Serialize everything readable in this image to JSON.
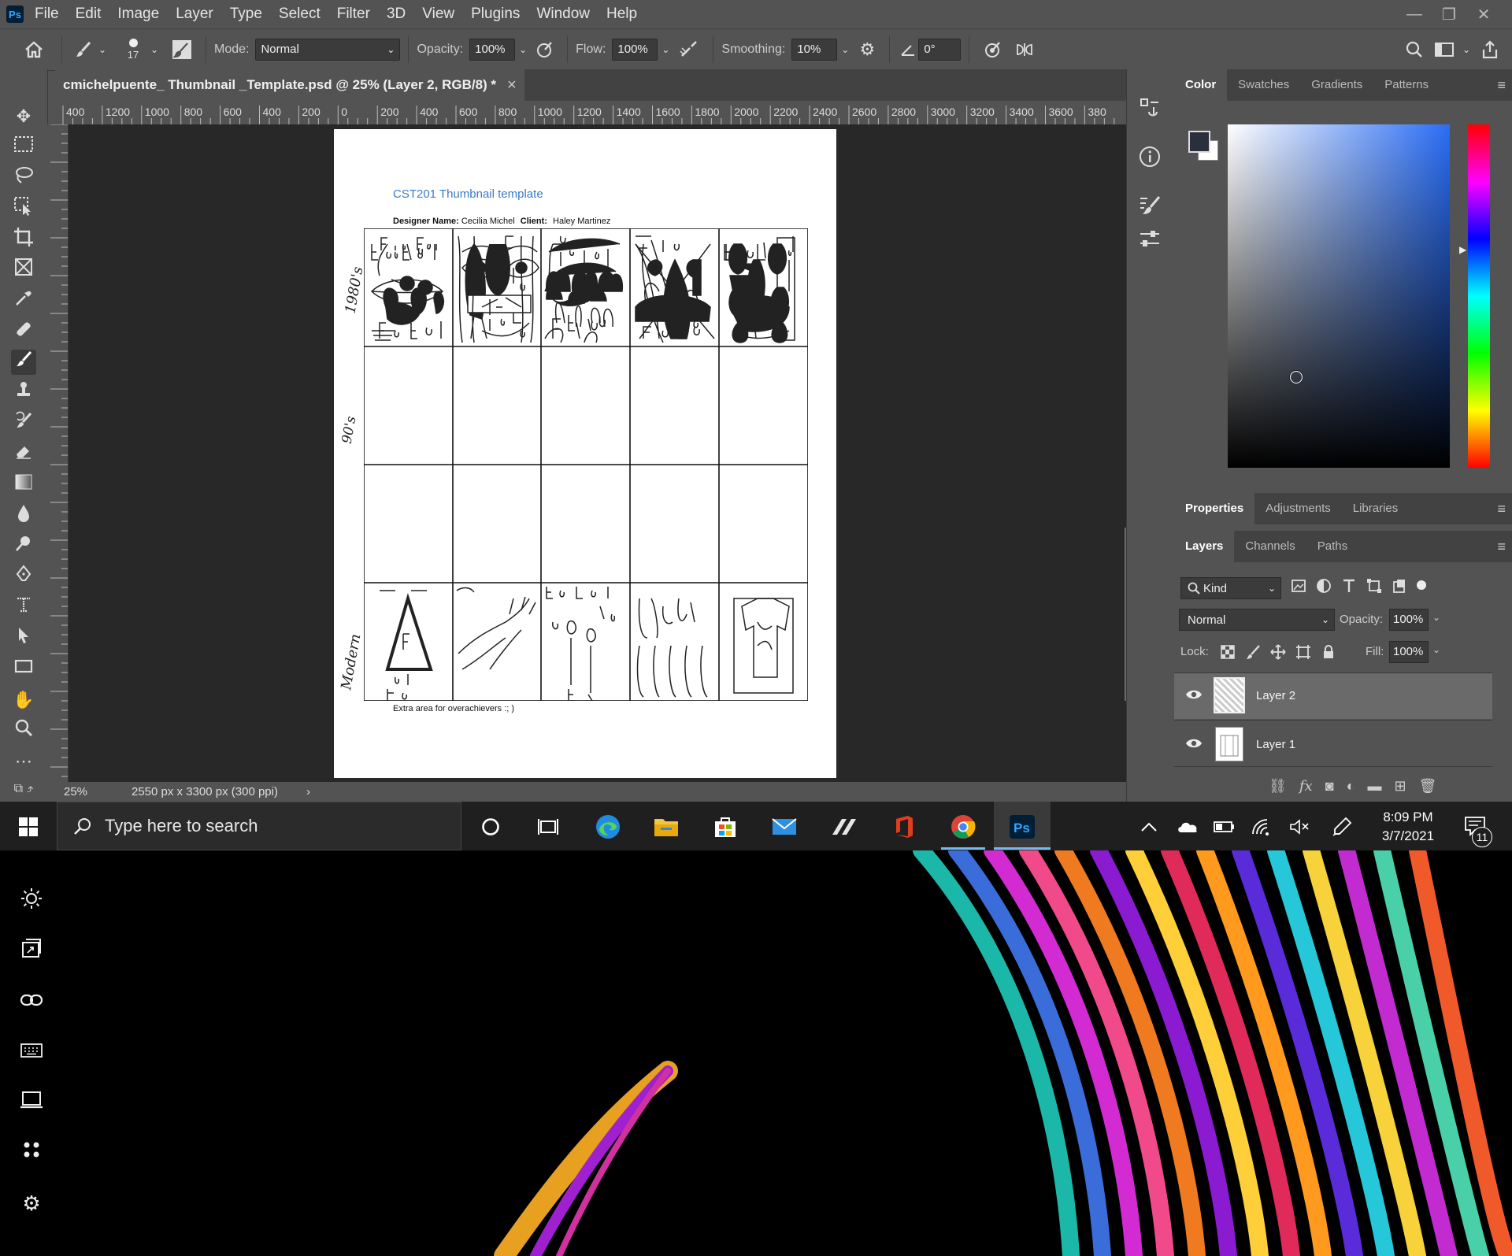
{
  "app": {
    "logo": "Ps",
    "menu": [
      "File",
      "Edit",
      "Image",
      "Layer",
      "Type",
      "Select",
      "Filter",
      "3D",
      "View",
      "Plugins",
      "Window",
      "Help"
    ]
  },
  "options": {
    "brush_size": "17",
    "mode_label": "Mode:",
    "mode_value": "Normal",
    "opacity_label": "Opacity:",
    "opacity_value": "100%",
    "flow_label": "Flow:",
    "flow_value": "100%",
    "smoothing_label": "Smoothing:",
    "smoothing_value": "10%",
    "angle_value": "0°"
  },
  "document": {
    "tab_title": "cmichelpuente_ Thumbnail _Template.psd @ 25% (Layer 2, RGB/8) *",
    "close": "×",
    "ruler_labels": [
      "400",
      "1200",
      "1000",
      "800",
      "600",
      "400",
      "200",
      "0",
      "200",
      "400",
      "600",
      "800",
      "1000",
      "1200",
      "1400",
      "1600",
      "1800",
      "2000",
      "2200",
      "2400",
      "2600",
      "2800",
      "3000",
      "3200",
      "3400",
      "3600",
      "380"
    ],
    "zoom": "25%",
    "dimensions": "2550 px x 3300 px (300 ppi)",
    "status_arrow": "›"
  },
  "page": {
    "heading": "CST201 Thumbnail template",
    "designer_label": "Designer Name:",
    "designer": "Cecilia Michel",
    "client_label": "Client:",
    "client": "Haley Martinez",
    "row_labels": [
      "1980's",
      "90's",
      "Modern"
    ],
    "footer": "Extra area for overachievers :; )"
  },
  "panels": {
    "color_tabs": [
      "Color",
      "Swatches",
      "Gradients",
      "Patterns"
    ],
    "props_tabs": [
      "Properties",
      "Adjustments",
      "Libraries"
    ],
    "layer_tabs": [
      "Layers",
      "Channels",
      "Paths"
    ],
    "kind_label": "Kind",
    "blend_mode": "Normal",
    "opacity_label": "Opacity:",
    "opacity_value": "100%",
    "lock_label": "Lock:",
    "fill_label": "Fill:",
    "fill_value": "100%",
    "layers": [
      {
        "name": "Layer 2",
        "selected": true
      },
      {
        "name": "Layer 1",
        "selected": false
      }
    ]
  },
  "taskbar": {
    "search_placeholder": "Type here to search",
    "time": "8:09 PM",
    "date": "3/7/2021",
    "notification_count": "11"
  },
  "colors": {
    "accent": "#31a8ff",
    "ps_bg": "#535353",
    "canvas_bg": "#282828"
  }
}
